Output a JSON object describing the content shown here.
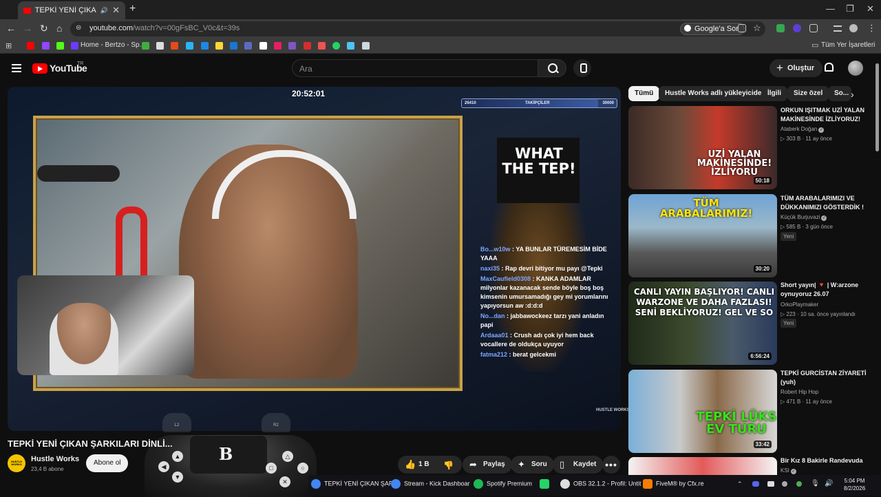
{
  "browser": {
    "tab_title": "TEPKİ YENİ ÇIKAN ŞARKILAR",
    "url_host": "youtube.com",
    "url_path": "/watch?v=00gFsBC_V0c&t=39s",
    "ask_google": "Google'a Sor",
    "bookmark_home": "Home - Bertzo - Sp...",
    "all_bookmarks": "Tüm Yer İşaretleri"
  },
  "youtube": {
    "wordmark": "YouTube",
    "country": "TR",
    "search_placeholder": "Ara",
    "create": "Oluştur"
  },
  "player": {
    "stream_clock": "20:52:01",
    "followers_current": "26410",
    "followers_label": "TAKİPÇİLER",
    "followers_goal": "30000",
    "followers_progress": 0.88,
    "poster_title": "WHAT THE TEP!",
    "watermark": "HUSTLE WORKS",
    "chat": [
      {
        "user": "Bo...w10w",
        "text": ": YA BUNLAR TÜREMESİM BİDE YAAA"
      },
      {
        "user": "naxi35",
        "text": ": Rap devri bitiyor mu payı @Tepki"
      },
      {
        "user": "MaxCaufield0308",
        "text": ": KANKA ADAMLAR milyonlar kazanacak sende böyle boş boş kimsenin umursamadığı gey mi yorumlarını yapıyorsun aw :d:d:d"
      },
      {
        "user": "No...dan",
        "text": ": jabbawockeez tarzı yani anladın papi"
      },
      {
        "user": "Ardaaa01",
        "text": ": Crush adı çok iyi hem back vocallere de oldukça uyuyor"
      },
      {
        "user": "fatma212",
        "text": ": berat gelcekmi"
      }
    ],
    "controller_logo": "B",
    "l2": "L2",
    "r2": "R2"
  },
  "video": {
    "title": "TEPKİ YENİ ÇIKAN ŞARKILARI DİNLİ...",
    "channel": "Hustle Works",
    "channel_logo": "HUSTLE WORKS",
    "subscribers": "23,4 B abone",
    "subscribe": "Abone ol",
    "likes": "1 B",
    "share": "Paylaş",
    "ask": "Soru",
    "save": "Kaydet"
  },
  "chips": [
    "Tümü",
    "Hustle Works adlı yükleyiciden",
    "İlgili",
    "Size özel",
    "So..."
  ],
  "recommendations": [
    {
      "title": "ORKUN IŞITMAK UZİ YALAN MAKİNESİNDE İZLİYORUZ!",
      "channel": "Ataberk Doğan",
      "meta": "303 B  ·  11 ay önce",
      "duration": "50:18",
      "thumb_text": "UZİ YALAN MAKİNESİNDE! İZLİYORU",
      "new": ""
    },
    {
      "title": "TÜM ARABALARIMIZI VE DÜKKANIMIZI GÖSTERDİK !",
      "channel": "Küçük Burjuvazi",
      "meta": "585 B  ·  3 gün önce",
      "duration": "30:20",
      "thumb_text": "TÜM ARABALARIMIZ!",
      "new": "Yeni"
    },
    {
      "title": "Short yayın| 🔻 | W:arzone oynuyoruz 26.07",
      "channel": "OrkoPlaymaker",
      "meta": "223  ·  10 sa. önce yayınlandı",
      "duration": "6:56:24",
      "thumb_text": "CANLI YAYIN BAŞLIYOR! CANLI WARZONE VE DAHA FAZLASI! SENİ BEKLİYORUZ! GEL VE SO",
      "new": "Yeni"
    },
    {
      "title": "TEPKİ GURCİSTAN ZİYARETİ (yuh)",
      "channel": "Robert Hip Hop",
      "meta": "471 B  ·  11 ay önce",
      "duration": "33:42",
      "thumb_text": "TEPKİ LÜKS EV TURU",
      "new": ""
    },
    {
      "title": "Bir Kız 8 Bakirle Randevuda",
      "channel": "KSI",
      "meta": "",
      "duration": "",
      "thumb_text": "",
      "new": ""
    }
  ],
  "taskbar": [
    {
      "label": "TEPKİ YENİ ÇIKAN ŞARK",
      "color": "#4285f4"
    },
    {
      "label": "Stream - Kick Dashboar",
      "color": "#4285f4"
    },
    {
      "label": "Spotify Premium",
      "color": "#1db954"
    },
    {
      "label": "",
      "color": "#25d366"
    },
    {
      "label": "OBS 32.1.2 - Profil: Untit",
      "color": "#dddddd"
    },
    {
      "label": "FiveM® by Cfx.re",
      "color": "#f57c00"
    }
  ],
  "clock": {
    "time": "5:04 PM",
    "date": "8/2/2026"
  }
}
